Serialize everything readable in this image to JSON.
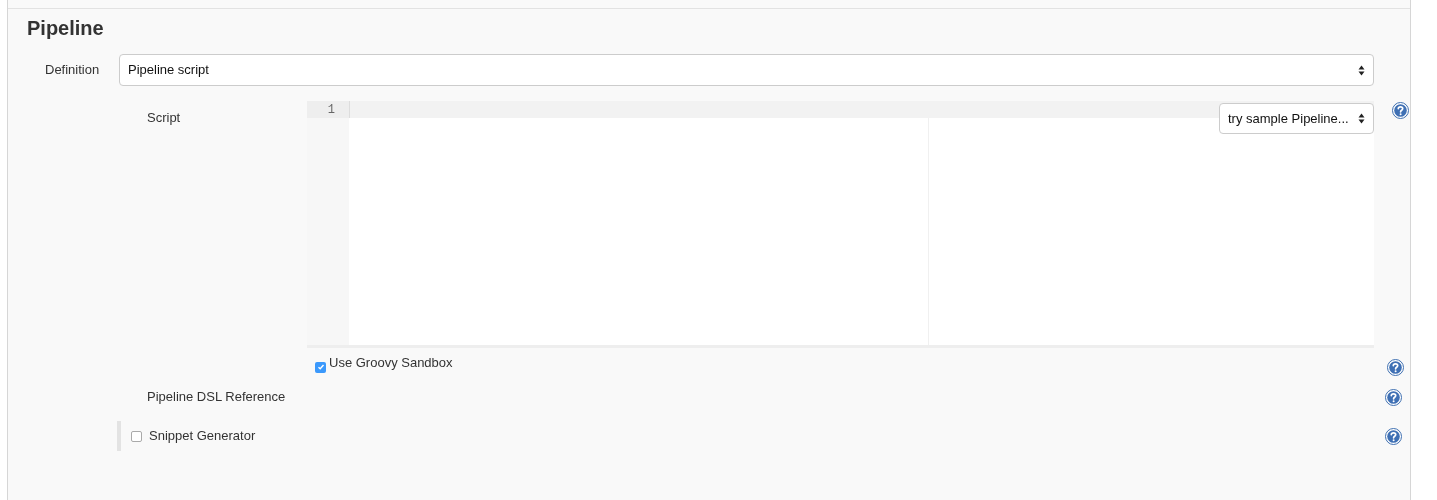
{
  "section": {
    "title": "Pipeline"
  },
  "definition": {
    "label": "Definition",
    "value": "Pipeline script"
  },
  "script": {
    "label": "Script",
    "line_numbers": [
      "1"
    ],
    "sample_select": "try sample Pipeline..."
  },
  "options": [
    {
      "kind": "checkbox",
      "label": "Use Groovy Sandbox",
      "checked": true,
      "help": true
    },
    {
      "kind": "link",
      "label": "Pipeline DSL Reference",
      "help": true
    },
    {
      "kind": "section-checkbox",
      "label": "Snippet Generator",
      "checked": false,
      "help": true
    }
  ]
}
